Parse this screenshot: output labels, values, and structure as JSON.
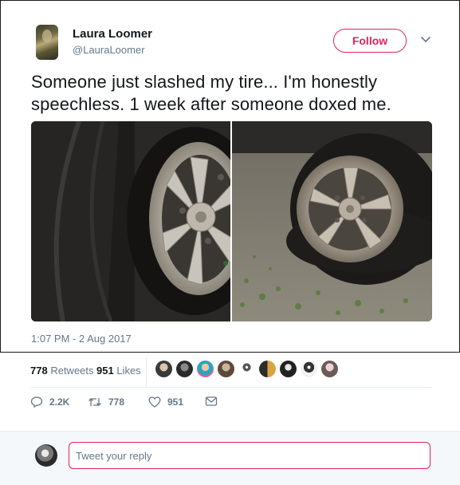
{
  "tweet": {
    "author_name": "Laura Loomer",
    "author_handle": "@LauraLoomer",
    "follow_label": "Follow",
    "text": "Someone just slashed my tire... I'm honestly speechless. 1 week after someone doxed me.",
    "timestamp": "1:07 PM - 2 Aug 2017"
  },
  "stats": {
    "retweets_count": "778",
    "retweets_label": "Retweets",
    "likes_count": "951",
    "likes_label": "Likes",
    "liker_avatar_count": 10
  },
  "actions": {
    "replies": "2.2K",
    "retweets": "778",
    "likes": "951"
  },
  "reply": {
    "placeholder": "Tweet your reply"
  },
  "icons": {
    "reply": "reply-bubble-icon",
    "retweet": "retweet-arrows-icon",
    "like": "heart-icon",
    "dm": "envelope-icon",
    "more": "chevron-down-icon"
  },
  "colors": {
    "accent": "#e0245e",
    "secondary_text": "#657786",
    "primary_text": "#14171a",
    "divider": "#e6ecf0"
  }
}
